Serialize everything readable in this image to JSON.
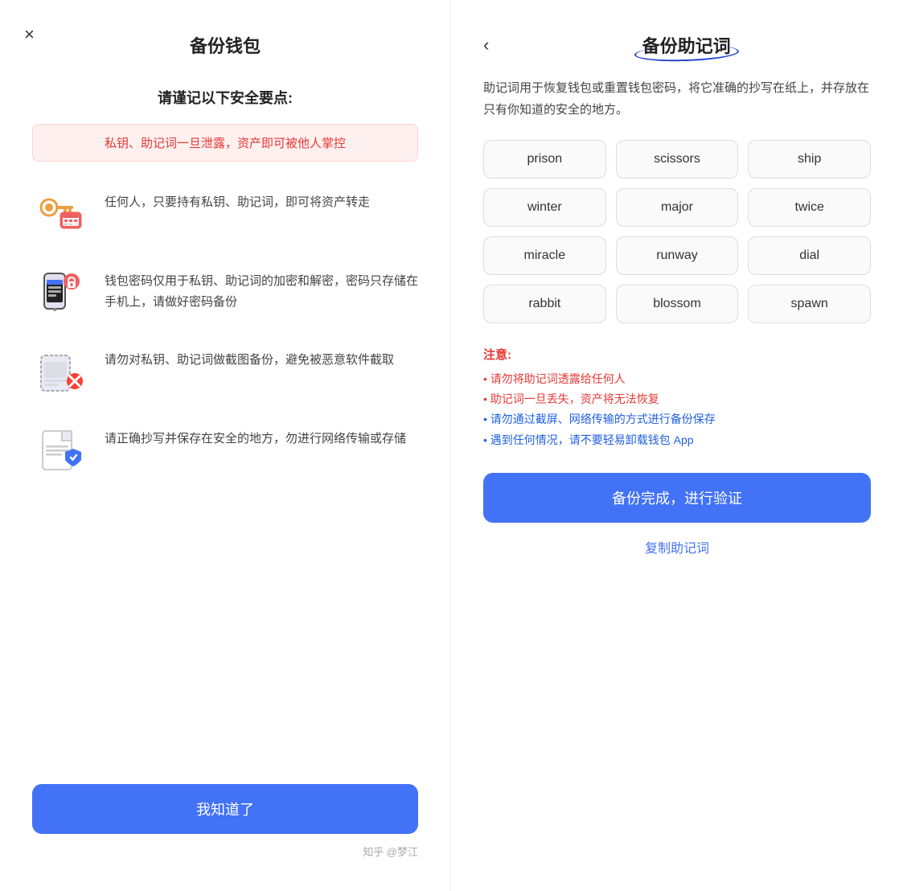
{
  "left": {
    "close_icon": "×",
    "title": "备份钱包",
    "subtitle": "请谨记以下安全要点:",
    "warning": "私钥、助记词一旦泄露，资产即可被他人掌控",
    "tips": [
      {
        "id": "tip-key",
        "icon_name": "key-wallet-icon",
        "text": "任何人，只要持有私钥、助记词，即可将资产转走"
      },
      {
        "id": "tip-phone",
        "icon_name": "phone-lock-icon",
        "text": "钱包密码仅用于私钥、助记词的加密和解密，密码只存储在手机上，请做好密码备份"
      },
      {
        "id": "tip-screenshot",
        "icon_name": "screenshot-ban-icon",
        "text": "请勿对私钥、助记词做截图备份，避免被恶意软件截取"
      },
      {
        "id": "tip-paper",
        "icon_name": "paper-backup-icon",
        "text": "请正确抄写并保存在安全的地方，勿进行网络传输或存储"
      }
    ],
    "confirm_btn": "我知道了"
  },
  "right": {
    "back_icon": "‹",
    "title": "备份助记词",
    "desc": "助记词用于恢复钱包或重置钱包密码，将它准确的抄写在纸上，并存放在只有你知道的安全的地方。",
    "mnemonic_words": [
      "prison",
      "scissors",
      "ship",
      "winter",
      "major",
      "twice",
      "miracle",
      "runway",
      "dial",
      "rabbit",
      "blossom",
      "spawn"
    ],
    "notes_title": "注意:",
    "notes": [
      {
        "text": "• 请勿将助记词透露给任何人",
        "style": "red"
      },
      {
        "text": "• 助记词一旦丢失，资产将无法恢复",
        "style": "red"
      },
      {
        "text": "• 请勿通过截屏、网络传输的方式进行备份保存",
        "style": "blue"
      },
      {
        "text": "• 遇到任何情况，请不要轻易卸载钱包 App",
        "style": "blue"
      }
    ],
    "confirm_btn": "备份完成，进行验证",
    "copy_link": "复制助记词"
  },
  "watermark": "知乎 @梦江"
}
